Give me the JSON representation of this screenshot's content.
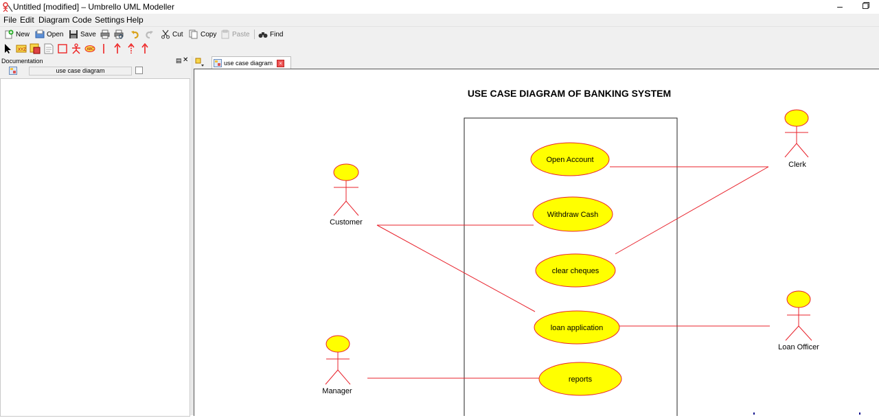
{
  "window": {
    "title": "Untitled [modified] – Umbrello UML Modeller"
  },
  "menu": [
    "File",
    "Edit",
    "Diagram",
    "Code",
    "Settings",
    "Help"
  ],
  "toolbar": {
    "new_label": "New",
    "open_label": "Open",
    "save_label": "Save",
    "cut_label": "Cut",
    "copy_label": "Copy",
    "paste_label": "Paste",
    "find_label": "Find"
  },
  "documentation": {
    "title": "Documentation",
    "diagram_name": "use case diagram"
  },
  "tab": {
    "label": "use case diagram"
  },
  "diagram": {
    "title": "USE CASE DIAGRAM OF BANKING SYSTEM",
    "actors": [
      "Customer",
      "Clerk",
      "Loan Officer",
      "Manager"
    ],
    "use_cases": [
      "Open Account",
      "Withdraw Cash",
      "clear cheques",
      "loan application",
      "reports"
    ],
    "colors": {
      "fill": "#ffff00",
      "stroke": "#e8202a",
      "line": "#e8202a"
    }
  }
}
